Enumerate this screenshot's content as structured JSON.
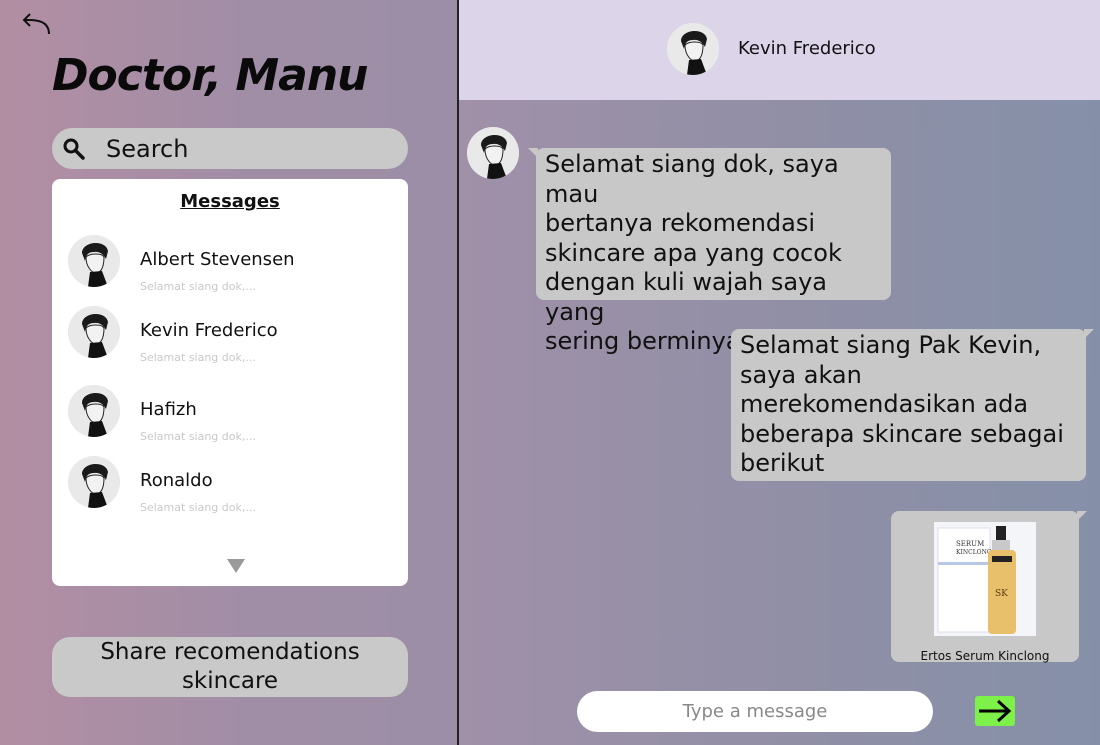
{
  "sidebar": {
    "title": "Doctor, Manu",
    "search_label": "Search",
    "messages_heading": "Messages",
    "contacts": [
      {
        "name": "Albert Stevensen",
        "preview": "Selamat siang dok,..."
      },
      {
        "name": "Kevin Frederico",
        "preview": "Selamat siang dok,..."
      },
      {
        "name": "Hafizh",
        "preview": "Selamat siang dok,..."
      },
      {
        "name": "Ronaldo",
        "preview": "Selamat siang dok,..."
      }
    ],
    "share_button_label": "Share recomendations skincare"
  },
  "chat": {
    "header_name": "Kevin Frederico",
    "messages": [
      {
        "from": "patient",
        "text": "Selamat siang dok, saya mau\nbertanya rekomendasi\nskincare apa yang cocok\ndengan kuli wajah saya yang\nsering berminyak"
      },
      {
        "from": "doctor",
        "text": "Selamat siang Pak Kevin,\nsaya akan\nmerekomendasikan ada\nbeberapa skincare sebagai\nberikut"
      }
    ],
    "product": {
      "name": "Ertos Serum Kinclong",
      "box_text": "SERUM\nKINCLONG",
      "bottle_label": "SK"
    },
    "composer_placeholder": "Type a message"
  },
  "colors": {
    "send_button": "#7ef04a",
    "header_bg": "#dcd5ea",
    "bubble_bg": "#c8c8c8"
  },
  "icons": {
    "back": "back-arrow-icon",
    "search": "search-icon",
    "send": "arrow-right-icon",
    "scroll": "triangle-down-icon"
  }
}
